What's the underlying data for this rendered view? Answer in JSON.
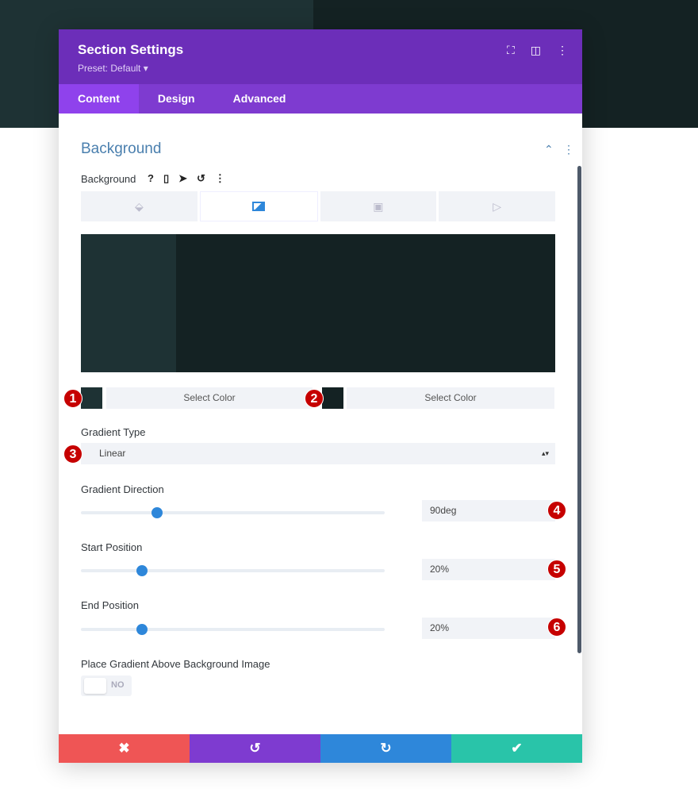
{
  "header": {
    "title": "Section Settings",
    "preset": "Preset: Default ▾",
    "icons": [
      "focus-icon",
      "sidebar-layout-icon",
      "more-vertical-icon"
    ]
  },
  "tabs": [
    {
      "label": "Content",
      "active": true
    },
    {
      "label": "Design"
    },
    {
      "label": "Advanced"
    }
  ],
  "section": {
    "title": "Background",
    "label": "Background"
  },
  "bg_tabs": [
    "color-fill-icon",
    "gradient-icon",
    "image-icon",
    "video-icon"
  ],
  "colors": {
    "stop1": "#1e3234",
    "stop2": "#142223",
    "accent": "#2e87da",
    "header": "#6c2eb9"
  },
  "color_pickers": [
    {
      "badge": "1",
      "label": "Select Color"
    },
    {
      "badge": "2",
      "label": "Select Color"
    }
  ],
  "gradient_type": {
    "label": "Gradient Type",
    "value": "Linear",
    "badge": "3"
  },
  "gradient_direction": {
    "label": "Gradient Direction",
    "value": "90deg",
    "badge": "4",
    "fraction": 0.25
  },
  "start_position": {
    "label": "Start Position",
    "value": "20%",
    "badge": "5",
    "fraction": 0.2
  },
  "end_position": {
    "label": "End Position",
    "value": "20%",
    "badge": "6",
    "fraction": 0.2
  },
  "place_above": {
    "label": "Place Gradient Above Background Image",
    "value": "NO"
  },
  "footer": {
    "cancel": "✖",
    "undo": "↺",
    "redo": "↻",
    "save": "✔"
  }
}
